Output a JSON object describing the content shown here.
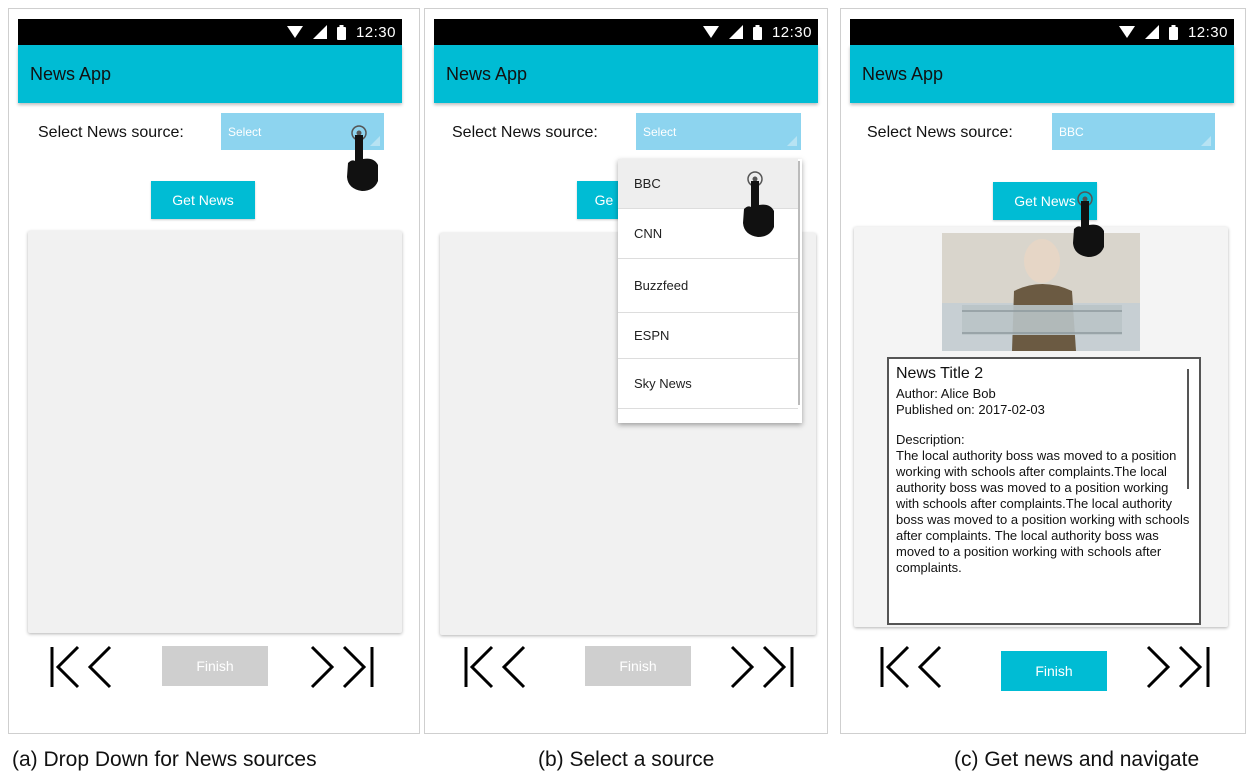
{
  "status": {
    "time": "12:30"
  },
  "app": {
    "title": "News App"
  },
  "labels": {
    "select_source": "Select News source:",
    "get_news": "Get News",
    "finish": "Finish"
  },
  "screen_a": {
    "dropdown_value": "Select",
    "finish_enabled": false
  },
  "screen_b": {
    "dropdown_value": "Select",
    "get_news_partial": "Ge",
    "options": [
      "BBC",
      "CNN",
      "Buzzfeed",
      "ESPN",
      "Sky News"
    ],
    "highlighted_option": "BBC",
    "finish_enabled": false
  },
  "screen_c": {
    "dropdown_value": "BBC",
    "finish_enabled": true,
    "news": {
      "title": "News Title 2",
      "author": "Author: Alice Bob",
      "published": "Published on: 2017-02-03",
      "description_label": "Description:",
      "description": "The local authority boss was moved to a position working with schools after complaints.The local authority boss was moved to a position working with schools after complaints.The local authority boss was moved to a position working with schools after complaints. The local authority boss was moved to a position working with schools after complaints."
    }
  },
  "captions": {
    "a": "(a) Drop Down for News sources",
    "b": "(b) Select a source",
    "c": "(c) Get news and navigate"
  },
  "colors": {
    "accent": "#00bcd4",
    "dropdown": "#8dd4ef",
    "disabled": "#cfcfcf",
    "statusbar": "#000000"
  },
  "icons": [
    "wifi-icon",
    "signal-icon",
    "battery-icon",
    "first-page-icon",
    "last-page-icon",
    "hand-pointer-icon"
  ]
}
